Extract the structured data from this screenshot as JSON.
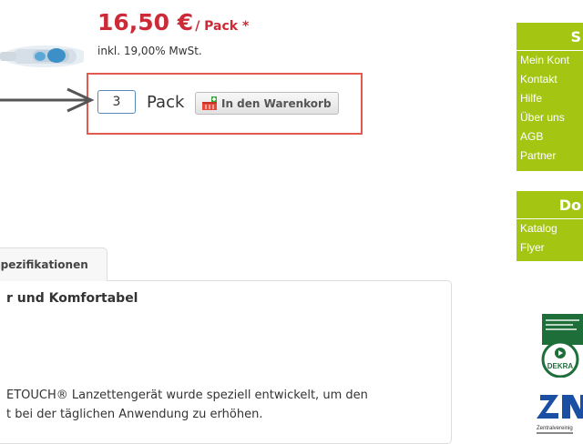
{
  "product": {
    "price": "16,50 €",
    "price_unit": "/ Pack *",
    "vat_note": "inkl. 19,00% MwSt."
  },
  "order": {
    "quantity": "3",
    "unit": "Pack",
    "cart_button_label": "In den Warenkorb"
  },
  "tabs": {
    "active_label": "Spezifikationen"
  },
  "content": {
    "heading": "r und Komfortabel",
    "line1": "ETOUCH® Lanzettengerät wurde speziell entwickelt, um den",
    "line2": "t bei der täglichen Anwendung zu erhöhen."
  },
  "sidebar": {
    "box1_title": "S",
    "box1_links": [
      "Mein Kont",
      "Kontakt",
      "Hilfe",
      "Über uns",
      "AGB",
      "Partner"
    ],
    "box2_title": "Do",
    "box2_links": [
      "Katalog",
      "Flyer"
    ]
  },
  "badges": {
    "badge1_text": "DEKRA",
    "badge2_caption": "Zentralvereinig"
  },
  "colors": {
    "price_red": "#cc2a36",
    "sidebar_green": "#a5c513",
    "highlight_red": "#e35a50",
    "input_blue": "#5a86b8"
  },
  "icons": {
    "cart_button": "cart-add-icon",
    "arrow": "pointer-arrow-icon"
  }
}
